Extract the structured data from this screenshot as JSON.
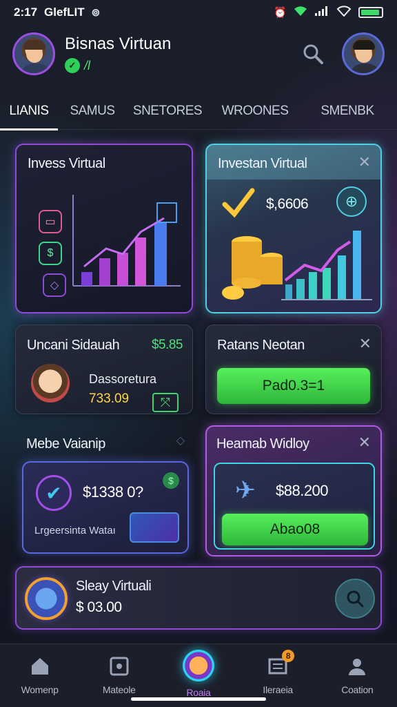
{
  "status_bar": {
    "time": "2:17",
    "carrier": "GlefLIT"
  },
  "header": {
    "title": "Bisnas Virtuan",
    "sub_text": "/l"
  },
  "tabs": [
    {
      "label": "LIANIS",
      "active": true
    },
    {
      "label": "SAMUS",
      "active": false
    },
    {
      "label": "SNETORES",
      "active": false
    },
    {
      "label": "WROONES",
      "active": false
    },
    {
      "label": "SMENBK",
      "active": false
    }
  ],
  "cards": {
    "invest_virtual": {
      "title": "Invess Virtual"
    },
    "investan_virtual": {
      "title": "Investan Virtual",
      "amount": "$,6606"
    },
    "uncani": {
      "title": "Uncani Sidauah",
      "amount": "$5.85",
      "label": "Dassoretura",
      "value": "733.09"
    },
    "ratans": {
      "title": "Ratans Neotan",
      "button": "Pad0.3=1"
    },
    "mebe": {
      "title": "Mebe Vaianip",
      "amount": "$1338 0?",
      "label": "Lrgeersinta Wataı"
    },
    "heamab": {
      "title": "Heamab Widloy",
      "amount": "$88.200",
      "button": "Abao08"
    },
    "sleay": {
      "title": "Sleay Virtuali",
      "amount": "$ 03.00"
    }
  },
  "bottom_nav": [
    {
      "label": "Womenp",
      "icon": "home-icon"
    },
    {
      "label": "Mateole",
      "icon": "square-icon"
    },
    {
      "label": "Roaia",
      "icon": "mail-icon",
      "active": true
    },
    {
      "label": "Ileraeia",
      "icon": "news-icon",
      "badge": "8"
    },
    {
      "label": "Coation",
      "icon": "profile-icon"
    }
  ],
  "colors": {
    "accent_purple": "#8e4bd8",
    "accent_cyan": "#4fd0e4",
    "accent_green": "#4fe07a",
    "background": "#161a26"
  }
}
